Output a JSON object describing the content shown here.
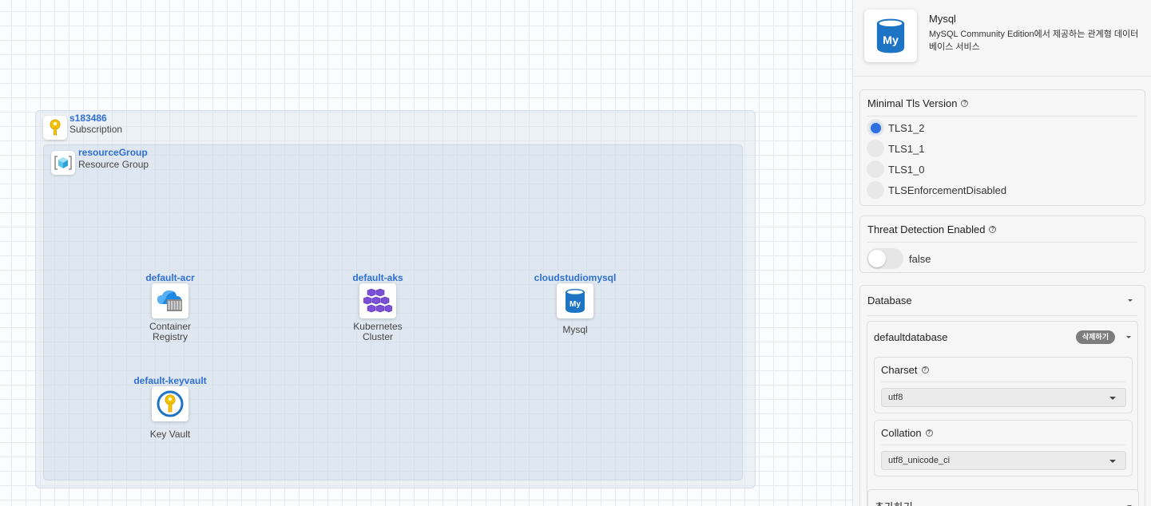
{
  "canvas": {
    "subscription": {
      "name": "s183486",
      "type": "Subscription"
    },
    "resource_group": {
      "name": "resourceGroup",
      "type": "Resource Group"
    },
    "nodes": [
      {
        "name": "default-acr",
        "type": "Container\nRegistry",
        "icon": "container-registry-icon"
      },
      {
        "name": "default-aks",
        "type": "Kubernetes\nCluster",
        "icon": "kubernetes-icon"
      },
      {
        "name": "cloudstudiomysql",
        "type": "Mysql",
        "icon": "mysql-icon"
      },
      {
        "name": "default-keyvault",
        "type": "Key Vault",
        "icon": "key-vault-icon"
      }
    ]
  },
  "panel": {
    "header": {
      "title": "Mysql",
      "description": "MySQL Community Edition에서 제공하는 관계형 데이터베이스 서비스",
      "icon": "mysql-icon"
    },
    "tls": {
      "label": "Minimal Tls Version",
      "options": [
        "TLS1_2",
        "TLS1_1",
        "TLS1_0",
        "TLSEnforcementDisabled"
      ],
      "selected": "TLS1_2"
    },
    "threat": {
      "label": "Threat Detection Enabled",
      "value": "false",
      "enabled": false
    },
    "database": {
      "label": "Database",
      "item_name": "defaultdatabase",
      "delete_label": "삭제하기",
      "charset_label": "Charset",
      "charset_value": "utf8",
      "collation_label": "Collation",
      "collation_value": "utf8_unicode_ci",
      "add_label": "추가하기"
    }
  },
  "colors": {
    "accent": "#2d6fdc",
    "link": "#2f6fd3",
    "mysql": "#1e74c4"
  }
}
